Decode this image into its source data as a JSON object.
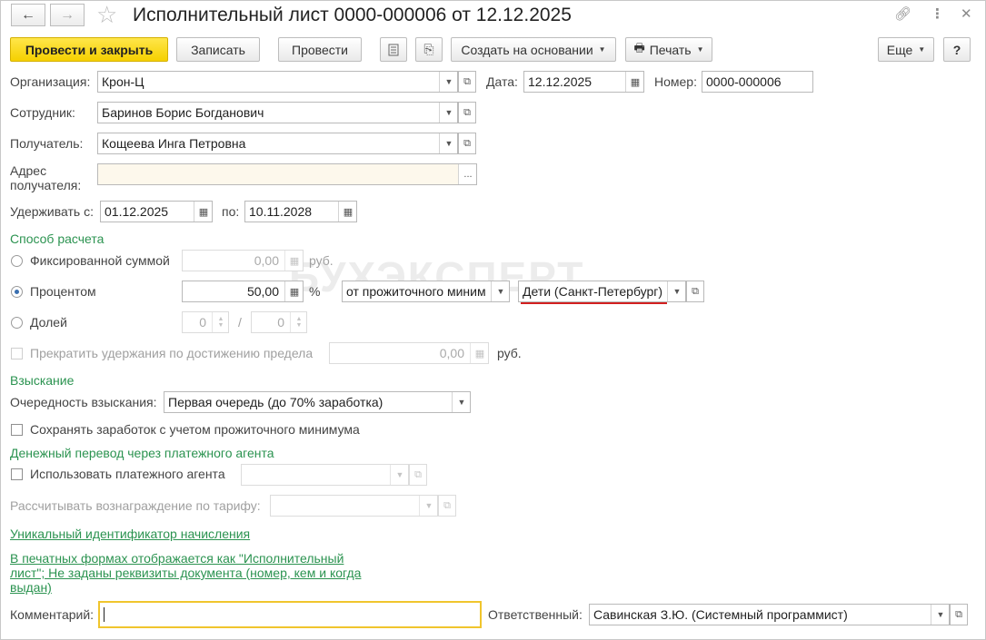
{
  "window": {
    "title": "Исполнительный лист 0000-000006 от 12.12.2025",
    "back_icon": "arrow-left",
    "forward_icon": "arrow-right",
    "favorite_icon": "star",
    "link_icon": "link",
    "menu_icon": "more-vertical",
    "close_icon": "close"
  },
  "toolbar": {
    "post_close": "Провести и закрыть",
    "save": "Записать",
    "post": "Провести",
    "create_based": "Создать на основании",
    "print": "Печать",
    "more": "Еще",
    "help": "?"
  },
  "form": {
    "org_label": "Организация:",
    "org_value": "Крон-Ц",
    "date_label": "Дата:",
    "date_value": "12.12.2025",
    "number_label": "Номер:",
    "number_value": "0000-000006",
    "employee_label": "Сотрудник:",
    "employee_value": "Баринов Борис Богданович",
    "recipient_label": "Получатель:",
    "recipient_value": "Кощеева Инга Петровна",
    "address_label_1": "Адрес",
    "address_label_2": "получателя:",
    "address_value": "",
    "address_btn": "...",
    "withhold_from_label": "Удерживать с:",
    "withhold_from_value": "01.12.2025",
    "to_label": "по:",
    "to_value": "10.11.2028"
  },
  "calc": {
    "section": "Способ расчета",
    "fixed_label": "Фиксированной суммой",
    "fixed_value": "0,00",
    "rub": "руб.",
    "percent_label": "Процентом",
    "percent_value": "50,00",
    "percent_sign": "%",
    "base_value": "от прожиточного миним",
    "region_value": "Дети (Санкт-Петербург)",
    "share_label": "Долей",
    "share_num": "0",
    "share_sep": "/",
    "share_den": "0",
    "stop_label": "Прекратить удержания по достижению предела",
    "stop_value": "0,00",
    "stop_rub": "руб.",
    "selected": "percent"
  },
  "recovery": {
    "section": "Взыскание",
    "order_label": "Очередность взыскания:",
    "order_value": "Первая очередь (до 70% заработка)",
    "keep_label": "Сохранять заработок с учетом прожиточного минимума",
    "transfer_section": "Денежный перевод через платежного агента",
    "agent_label": "Использовать платежного агента",
    "tariff_label": "Рассчитывать вознаграждение по тарифу:",
    "uid_link": "Уникальный идентификатор начисления",
    "print_link_1": "В печатных формах отображается как \"Исполнительный",
    "print_link_2": "лист\"; Не заданы реквизиты документа (номер, кем и когда",
    "print_link_3": "выдан)"
  },
  "footer": {
    "comment_label": "Комментарий:",
    "comment_value": "",
    "responsible_label": "Ответственный:",
    "responsible_value": "Савинская З.Ю. (Системный программист)"
  },
  "watermark": "БУХЭКСПЕРТ",
  "colors": {
    "accent_green": "#2b9350",
    "primary_button": "#f5d000",
    "highlight_red": "#d21f1f",
    "focus_border": "#f0c52d"
  }
}
